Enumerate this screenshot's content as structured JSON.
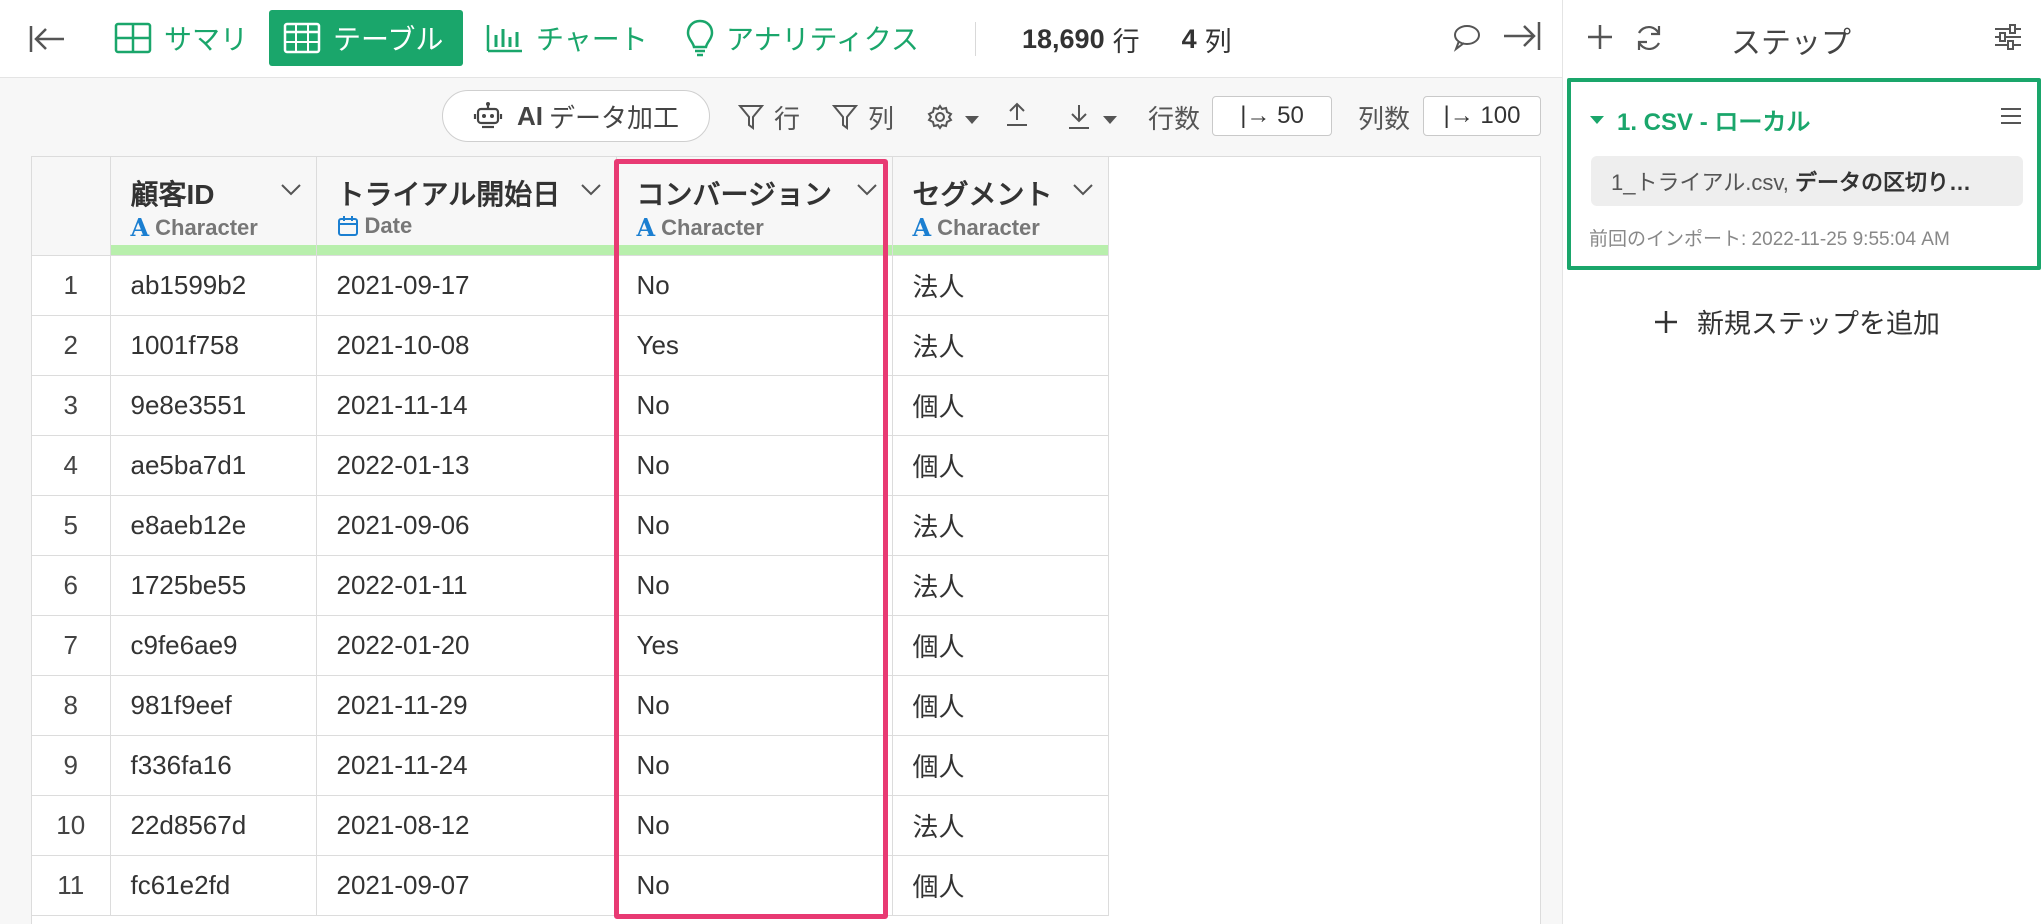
{
  "colors": {
    "accent": "#1aa66b",
    "highlight": "#e83a73",
    "quality": "#b8efac",
    "type_icon": "#1b7fd1"
  },
  "tabs": [
    {
      "label": "サマリ",
      "icon": "summary-grid-icon"
    },
    {
      "label": "テーブル",
      "icon": "table-icon",
      "active": true
    },
    {
      "label": "チャート",
      "icon": "bar-chart-icon"
    },
    {
      "label": "アナリティクス",
      "icon": "lightbulb-icon"
    }
  ],
  "counts": {
    "rows": "18,690",
    "rows_unit": "行",
    "cols": "4",
    "cols_unit": "列"
  },
  "toolbar": {
    "ai_prefix": "AI",
    "ai_label": "データ加工",
    "filter_row": "行",
    "filter_col": "列",
    "row_count_label": "行数",
    "row_count_value": "|→ 50",
    "col_count_label": "列数",
    "col_count_value": "|→ 100"
  },
  "table": {
    "columns": [
      {
        "name": "顧客ID",
        "type": "Character",
        "type_icon": "character-type-icon"
      },
      {
        "name": "トライアル開始日",
        "type": "Date",
        "type_icon": "calendar-icon"
      },
      {
        "name": "コンバージョン",
        "type": "Character",
        "type_icon": "character-type-icon"
      },
      {
        "name": "セグメント",
        "type": "Character",
        "type_icon": "character-type-icon"
      }
    ],
    "rows": [
      [
        "1",
        "ab1599b2",
        "2021-09-17",
        "No",
        "法人"
      ],
      [
        "2",
        "1001f758",
        "2021-10-08",
        "Yes",
        "法人"
      ],
      [
        "3",
        "9e8e3551",
        "2021-11-14",
        "No",
        "個人"
      ],
      [
        "4",
        "ae5ba7d1",
        "2022-01-13",
        "No",
        "個人"
      ],
      [
        "5",
        "e8aeb12e",
        "2021-09-06",
        "No",
        "法人"
      ],
      [
        "6",
        "1725be55",
        "2022-01-11",
        "No",
        "法人"
      ],
      [
        "7",
        "c9fe6ae9",
        "2022-01-20",
        "Yes",
        "個人"
      ],
      [
        "8",
        "981f9eef",
        "2021-11-29",
        "No",
        "個人"
      ],
      [
        "9",
        "f336fa16",
        "2021-11-24",
        "No",
        "個人"
      ],
      [
        "10",
        "22d8567d",
        "2021-08-12",
        "No",
        "法人"
      ],
      [
        "11",
        "fc61e2fd",
        "2021-09-07",
        "No",
        "個人"
      ]
    ]
  },
  "right_panel": {
    "title": "ステップ",
    "step": {
      "name": "1. CSV - ローカル",
      "desc_file": "1_トライアル.csv, ",
      "desc_bold": "データの区切り…",
      "time": "前回のインポート: 2022-11-25 9:55:04 AM"
    },
    "add_step": "新規ステップを追加"
  }
}
